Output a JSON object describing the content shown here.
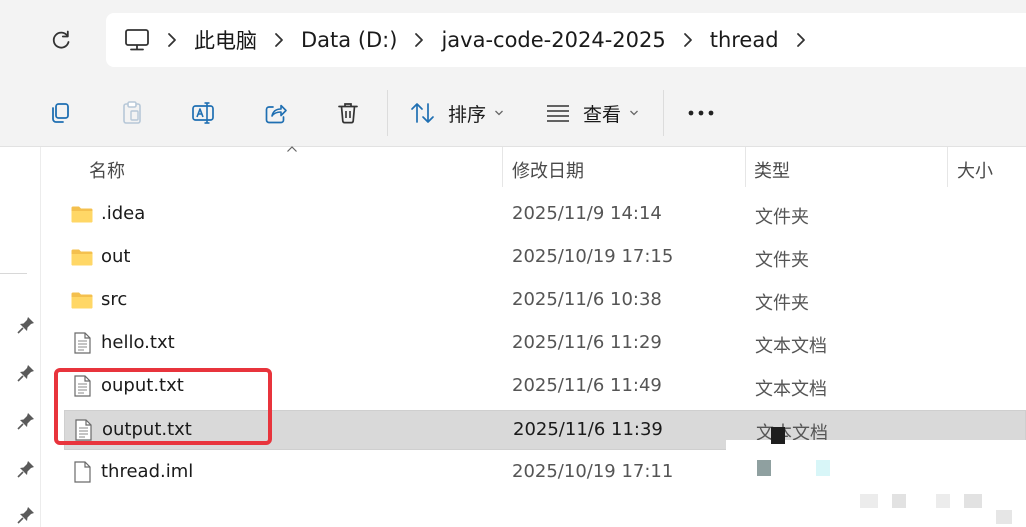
{
  "address": {
    "refresh_icon": "refresh-icon",
    "computer_icon": "computer-icon",
    "breadcrumbs": [
      "此电脑",
      "Data (D:)",
      "java-code-2024-2025",
      "thread"
    ]
  },
  "toolbar": {
    "buttons": [
      "copy-icon",
      "paste-icon",
      "rename-icon",
      "share-icon",
      "delete-icon"
    ],
    "sort_label": "排序",
    "view_label": "查看",
    "more_icon": "more-icon"
  },
  "columns": {
    "name": "名称",
    "date": "修改日期",
    "type": "类型",
    "size": "大小"
  },
  "files": [
    {
      "name": ".idea",
      "date": "2025/11/9 14:14",
      "type": "文件夹",
      "icon": "folder-icon"
    },
    {
      "name": "out",
      "date": "2025/10/19 17:15",
      "type": "文件夹",
      "icon": "folder-icon"
    },
    {
      "name": "src",
      "date": "2025/11/6 10:38",
      "type": "文件夹",
      "icon": "folder-icon"
    },
    {
      "name": "hello.txt",
      "date": "2025/11/6 11:29",
      "type": "文本文档",
      "icon": "text-file-icon"
    },
    {
      "name": "ouput.txt",
      "date": "2025/11/6 11:49",
      "type": "文本文档",
      "icon": "text-file-icon"
    },
    {
      "name": "output.txt",
      "date": "2025/11/6 11:39",
      "type": "文本文档",
      "icon": "text-file-icon",
      "selected": true
    },
    {
      "name": "thread.iml",
      "date": "2025/10/19 17:11",
      "type": "",
      "icon": "file-icon"
    }
  ],
  "colors": {
    "highlight": "#e8343c",
    "folder": "#f4c04e",
    "selection": "#d9d9d9",
    "accent_blue": "#1f6fb2"
  }
}
